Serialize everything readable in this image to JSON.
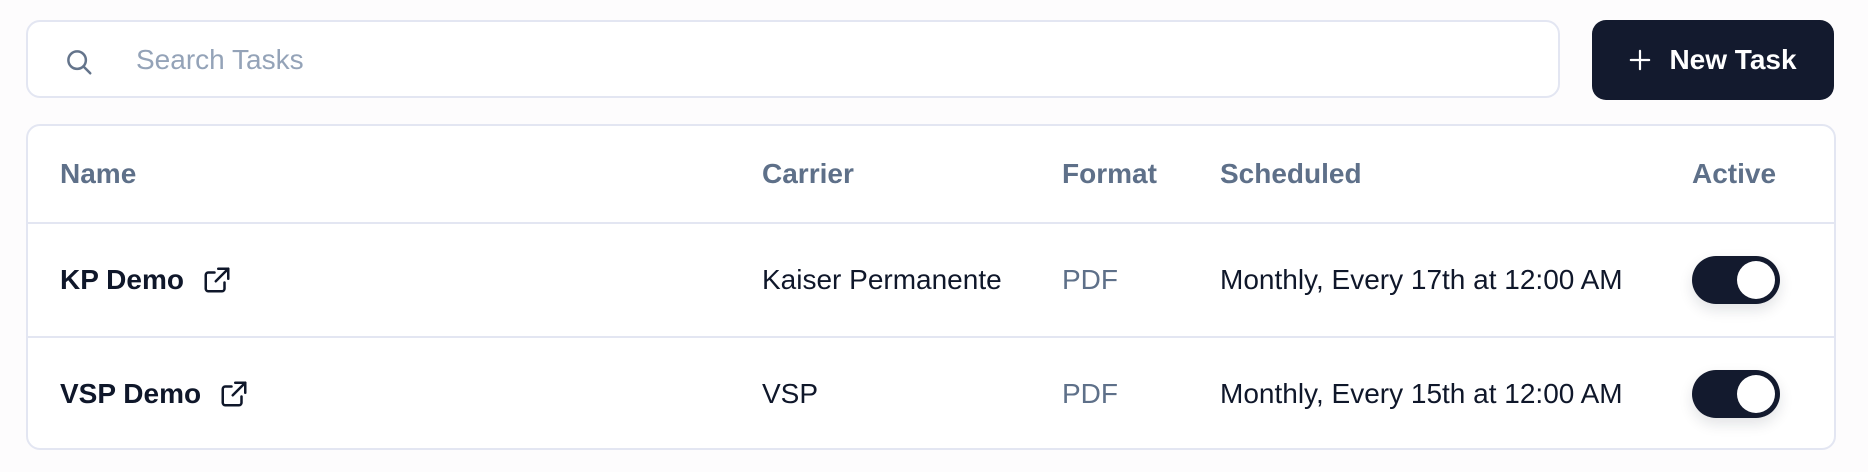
{
  "search": {
    "placeholder": "Search Tasks",
    "value": ""
  },
  "toolbar": {
    "new_task_label": "New Task"
  },
  "table": {
    "columns": [
      "Name",
      "Carrier",
      "Format",
      "Scheduled",
      "Active"
    ],
    "rows": [
      {
        "name": "KP Demo",
        "carrier": "Kaiser Permanente",
        "format": "PDF",
        "scheduled": "Monthly, Every 17th at 12:00 AM",
        "active": true
      },
      {
        "name": "VSP Demo",
        "carrier": "VSP",
        "format": "PDF",
        "scheduled": "Monthly, Every 15th at 12:00 AM",
        "active": true
      }
    ]
  },
  "icons": {
    "search": "search-icon",
    "add": "plus-icon",
    "open": "external-link-icon"
  },
  "colors": {
    "primary": "#131a2e",
    "muted_text": "#5e7089",
    "border": "#e3e6f2"
  }
}
